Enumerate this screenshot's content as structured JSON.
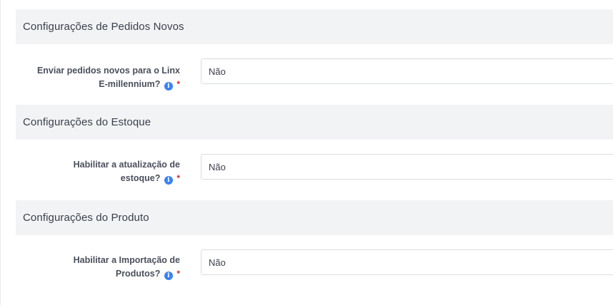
{
  "sections": [
    {
      "title": "Configurações de Pedidos Novos",
      "field": {
        "label_line1": "Enviar pedidos novos para o Linx",
        "label_line2": "E-millennium?",
        "value": "Não",
        "info_glyph": "i",
        "required_mark": "*"
      }
    },
    {
      "title": "Configurações do Estoque",
      "field": {
        "label_line1": "Habilitar a atualização de",
        "label_line2": "estoque?",
        "value": "Não",
        "info_glyph": "i",
        "required_mark": "*"
      }
    },
    {
      "title": "Configurações do Produto",
      "field": {
        "label_line1": "Habilitar a Importação de",
        "label_line2": "Produtos?",
        "value": "Não",
        "info_glyph": "i",
        "required_mark": "*"
      }
    }
  ],
  "colors": {
    "header_bg": "#f2f3f5",
    "info_icon": "#3b82f6",
    "required": "#e02424",
    "border": "#d9dce1"
  },
  "icons": {
    "info": "info-circle-icon"
  }
}
